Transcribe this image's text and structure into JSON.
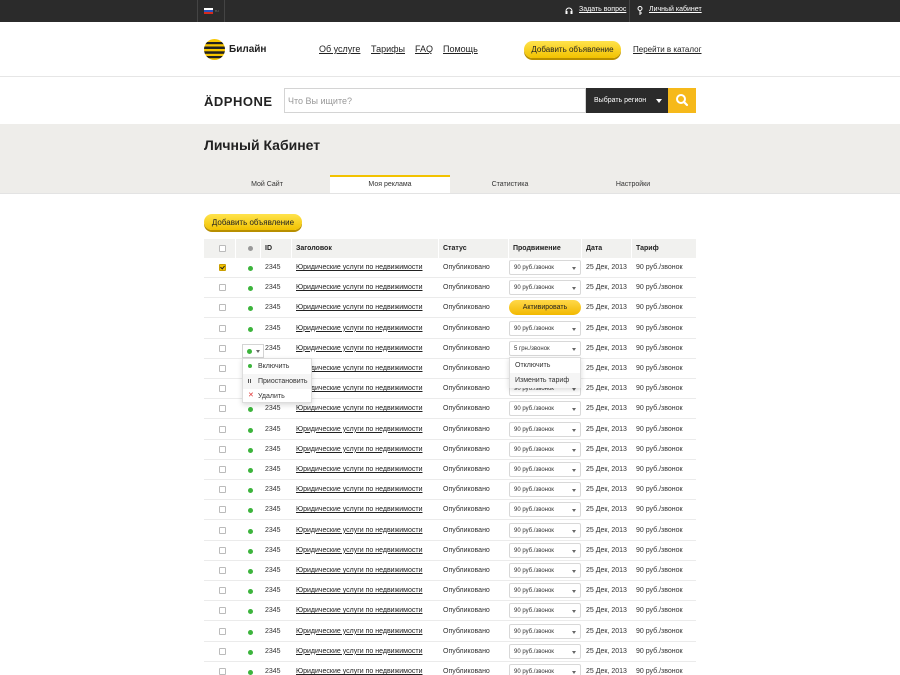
{
  "topbar": {
    "lang": "ru",
    "ask_question": "Задать вопрос",
    "cabinet": "Личный кабинет"
  },
  "header": {
    "brand": "Билайн",
    "nav": [
      "Об услуге",
      "Тарифы",
      "FAQ",
      "Помощь"
    ],
    "add_ad": "Добавить объявление",
    "catalog": "Перейти в каталог"
  },
  "search": {
    "logo": "ÄDPHONE",
    "placeholder": "Что Вы ищите?",
    "region": "Выбрать регион"
  },
  "page": {
    "title": "Личный Кабинет",
    "tabs": [
      "Мой Сайт",
      "Моя реклама",
      "Статистика",
      "Настройки"
    ],
    "active_tab": 1,
    "add_button": "Добавить объявление"
  },
  "table": {
    "headers": [
      "ID",
      "Заголовок",
      "Статус",
      "Продвижение",
      "Дата",
      "Тариф"
    ],
    "rows": [
      {
        "checked": true,
        "id": "2345",
        "title": "Юридические услуги по недвижимости",
        "status": "Опубликовано",
        "promo": "90 руб./звонок",
        "date": "25 Дек, 2013",
        "tariff": "90 руб./звонок"
      },
      {
        "checked": false,
        "id": "2345",
        "title": "Юридические услуги по недвижимости",
        "status": "Опубликовано",
        "promo": "90 руб./звонок",
        "date": "25 Дек, 2013",
        "tariff": "90 руб./звонок"
      },
      {
        "checked": false,
        "id": "2345",
        "title": "Юридические услуги по недвижимости",
        "status": "Опубликовано",
        "promo_button": "Активировать",
        "date": "25 Дек, 2013",
        "tariff": "90 руб./звонок"
      },
      {
        "checked": false,
        "id": "2345",
        "title": "Юридические услуги по недвижимости",
        "status": "Опубликовано",
        "promo": "90 руб./звонок",
        "date": "25 Дек, 2013",
        "tariff": "90 руб./звонок"
      },
      {
        "checked": false,
        "id": "2345",
        "title": "Юридические услуги по недвижимости",
        "status": "Опубликовано",
        "promo": "5 грн./звонок",
        "date": "25 Дек, 2013",
        "tariff": "90 руб./звонок"
      },
      {
        "checked": false,
        "id": "2345",
        "title": "Юридические услуги по недвижимости",
        "status": "Опубликовано",
        "promo": "90 руб./звонок",
        "date": "25 Дек, 2013",
        "tariff": "90 руб./звонок"
      },
      {
        "checked": false,
        "id": "2345",
        "title": "Юридические услуги по недвижимости",
        "status": "Опубликовано",
        "promo": "90 руб./звонок",
        "date": "25 Дек, 2013",
        "tariff": "90 руб./звонок"
      },
      {
        "checked": false,
        "id": "2345",
        "title": "Юридические услуги по недвижимости",
        "status": "Опубликовано",
        "promo": "90 руб./звонок",
        "date": "25 Дек, 2013",
        "tariff": "90 руб./звонок"
      },
      {
        "checked": false,
        "id": "2345",
        "title": "Юридические услуги по недвижимости",
        "status": "Опубликовано",
        "promo": "90 руб./звонок",
        "date": "25 Дек, 2013",
        "tariff": "90 руб./звонок"
      },
      {
        "checked": false,
        "id": "2345",
        "title": "Юридические услуги по недвижимости",
        "status": "Опубликовано",
        "promo": "90 руб./звонок",
        "date": "25 Дек, 2013",
        "tariff": "90 руб./звонок"
      },
      {
        "checked": false,
        "id": "2345",
        "title": "Юридические услуги по недвижимости",
        "status": "Опубликовано",
        "promo": "90 руб./звонок",
        "date": "25 Дек, 2013",
        "tariff": "90 руб./звонок"
      },
      {
        "checked": false,
        "id": "2345",
        "title": "Юридические услуги по недвижимости",
        "status": "Опубликовано",
        "promo": "90 руб./звонок",
        "date": "25 Дек, 2013",
        "tariff": "90 руб./звонок"
      },
      {
        "checked": false,
        "id": "2345",
        "title": "Юридические услуги по недвижимости",
        "status": "Опубликовано",
        "promo": "90 руб./звонок",
        "date": "25 Дек, 2013",
        "tariff": "90 руб./звонок"
      },
      {
        "checked": false,
        "id": "2345",
        "title": "Юридические услуги по недвижимости",
        "status": "Опубликовано",
        "promo": "90 руб./звонок",
        "date": "25 Дек, 2013",
        "tariff": "90 руб./звонок"
      },
      {
        "checked": false,
        "id": "2345",
        "title": "Юридические услуги по недвижимости",
        "status": "Опубликовано",
        "promo": "90 руб./звонок",
        "date": "25 Дек, 2013",
        "tariff": "90 руб./звонок"
      },
      {
        "checked": false,
        "id": "2345",
        "title": "Юридические услуги по недвижимости",
        "status": "Опубликовано",
        "promo": "90 руб./звонок",
        "date": "25 Дек, 2013",
        "tariff": "90 руб./звонок"
      },
      {
        "checked": false,
        "id": "2345",
        "title": "Юридические услуги по недвижимости",
        "status": "Опубликовано",
        "promo": "90 руб./звонок",
        "date": "25 Дек, 2013",
        "tariff": "90 руб./звонок"
      },
      {
        "checked": false,
        "id": "2345",
        "title": "Юридические услуги по недвижимости",
        "status": "Опубликовано",
        "promo": "90 руб./звонок",
        "date": "25 Дек, 2013",
        "tariff": "90 руб./звонок"
      },
      {
        "checked": false,
        "id": "2345",
        "title": "Юридические услуги по недвижимости",
        "status": "Опубликовано",
        "promo": "90 руб./звонок",
        "date": "25 Дек, 2013",
        "tariff": "90 руб./звонок"
      },
      {
        "checked": false,
        "id": "2345",
        "title": "Юридические услуги по недвижимости",
        "status": "Опубликовано",
        "promo": "90 руб./звонок",
        "date": "25 Дек, 2013",
        "tariff": "90 руб./звонок"
      },
      {
        "checked": false,
        "id": "2345",
        "title": "Юридические услуги по недвижимости",
        "status": "Опубликовано",
        "promo": "90 руб./звонок",
        "date": "25 Дек, 2013",
        "tariff": "90 руб./звонок"
      }
    ]
  },
  "status_menu": {
    "items": [
      "Включить",
      "Приостановить",
      "Удалить"
    ]
  },
  "promo_menu": {
    "items": [
      "Отключить",
      "Изменить тариф"
    ]
  },
  "colors": {
    "accent": "#f2c200",
    "dark": "#2b2b2b",
    "status_green": "#3cb43c",
    "delete_red": "#e03030"
  }
}
